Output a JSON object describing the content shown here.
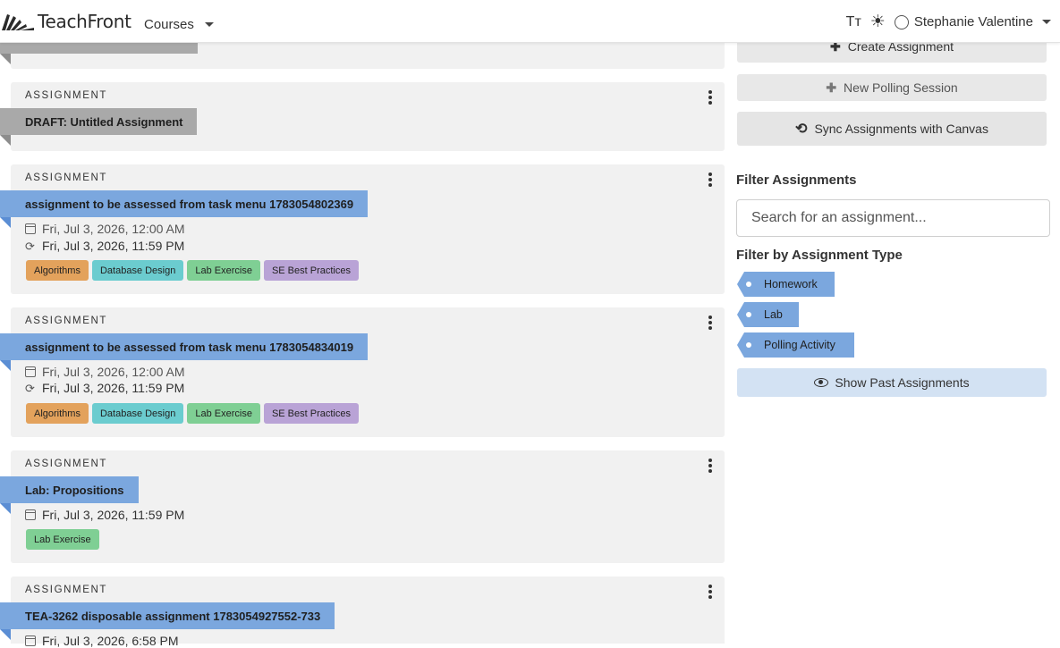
{
  "header": {
    "brand": "TeachFront",
    "courses_label": "Courses",
    "text_size_icon": "Tт",
    "theme_icon": "☀",
    "user_name": "Stephanie Valentine"
  },
  "assignments": [
    {
      "kicker": "ASSIGNMENT",
      "title": "DRAFT: Untitled Assignment",
      "style": "gray"
    },
    {
      "kicker": "ASSIGNMENT",
      "title": "assignment to be assessed from task menu 1783054802369",
      "style": "blue",
      "release": "Fri, Jul 3, 2026, 12:00 AM",
      "due": "Fri, Jul 3, 2026, 11:59 PM",
      "tags": [
        "Algorithms",
        "Database Design",
        "Lab Exercise",
        "SE Best Practices"
      ]
    },
    {
      "kicker": "ASSIGNMENT",
      "title": "assignment to be assessed from task menu 1783054834019",
      "style": "blue",
      "release": "Fri, Jul 3, 2026, 12:00 AM",
      "due": "Fri, Jul 3, 2026, 11:59 PM",
      "tags": [
        "Algorithms",
        "Database Design",
        "Lab Exercise",
        "SE Best Practices"
      ]
    },
    {
      "kicker": "ASSIGNMENT",
      "title": "Lab: Propositions",
      "style": "blue",
      "release": "Fri, Jul 3, 2026, 11:59 PM",
      "tags": [
        "Lab Exercise"
      ]
    },
    {
      "kicker": "ASSIGNMENT",
      "title": "TEA-3262 disposable assignment 1783054927552-733",
      "style": "blue",
      "release": "Fri, Jul 3, 2026, 6:58 PM"
    }
  ],
  "tag_colors": {
    "Algorithms": "#e3a25c",
    "Database Design": "#6bcccf",
    "Lab Exercise": "#7fcf94",
    "SE Best Practices": "#b9a3d6"
  },
  "sidebar": {
    "create_label": "Create Assignment",
    "polling_label": "New Polling Session",
    "sync_label": "Sync Assignments with Canvas",
    "filter_title": "Filter Assignments",
    "search_placeholder": "Search for an assignment...",
    "type_title": "Filter by Assignment Type",
    "types": [
      "Homework",
      "Lab",
      "Polling Activity"
    ],
    "show_past_label": "Show Past Assignments"
  },
  "colors": {
    "accent_blue": "#7ba7de",
    "draft_gray": "#a9a9a9",
    "show_past_bg": "#d3e2f3"
  }
}
